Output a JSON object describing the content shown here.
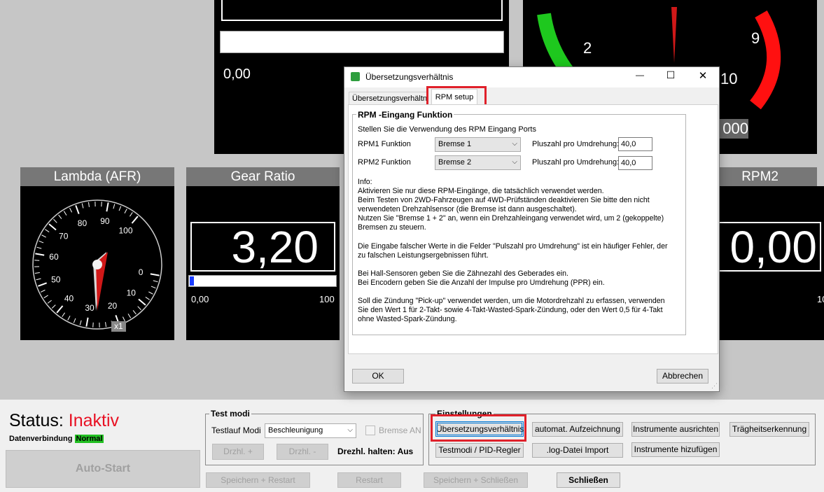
{
  "top_panels": {
    "left_value_text": "0,00",
    "right_gauge_ticks": [
      "2",
      "9",
      "10"
    ],
    "right_digit_text": "000"
  },
  "gauges": {
    "lambda": {
      "title": "Lambda (AFR)",
      "ticks": [
        "0",
        "10",
        "20",
        "30",
        "40",
        "50",
        "60",
        "70",
        "80",
        "90",
        "100"
      ],
      "multiplier": "x1"
    },
    "gear_ratio": {
      "title": "Gear Ratio",
      "value": "3,20",
      "bar_min": "0,00",
      "bar_max": "100",
      "bar_fraction": 0.03
    },
    "rpm2": {
      "title": "RPM2",
      "value": "0,00",
      "bar_max_partial": "10"
    }
  },
  "dialog": {
    "title": "Übersetzungsverhältnis",
    "window_buttons": {
      "minimize": "—",
      "maximize": "☐",
      "close": "✕"
    },
    "tabs": [
      {
        "label": "Übersetzungsverhältnis",
        "active": false
      },
      {
        "label": "RPM setup",
        "active": true
      }
    ],
    "group_title": "RPM -Eingang Funktion",
    "intro": "Stellen Sie die Verwendung des RPM Eingang Ports",
    "rpm1": {
      "label": "RPM1 Funktion",
      "select": "Bremse 1",
      "pulse_label": "Pluszahl pro Umdrehung:",
      "pulse_value": "40,0"
    },
    "rpm2": {
      "label": "RPM2 Funktion",
      "select": "Bremse 2",
      "pulse_label": "Pluszahl pro Umdrehung:",
      "pulse_value": "40,0"
    },
    "info": [
      "Info:",
      "Aktivieren Sie nur diese RPM-Eingänge, die tatsächlich verwendet werden.",
      "Beim Testen von 2WD-Fahrzeugen auf 4WD-Prüfständen deaktivieren Sie bitte den nicht",
      "verwendeten Drehzahlsensor (die Bremse ist dann ausgeschaltet).",
      "Nutzen Sie \"Bremse 1 + 2\" an, wenn ein Drehzahleingang verwendet wird, um 2 (gekoppelte)",
      "Bremsen zu steuern.",
      "",
      "Die Eingabe falscher Werte in die Felder \"Pulszahl pro Umdrehung\" ist ein häufiger Fehler, der",
      "zu falschen Leistungsergebnissen führt.",
      "",
      "Bei Hall-Sensoren geben Sie die Zähnezahl des Geberades ein.",
      "Bei Encodern geben Sie die Anzahl der Impulse pro Umdrehung (PPR) ein.",
      "",
      "Soll die Zündung \"Pick-up\" verwendet werden, um die Motordrehzahl zu erfassen, verwenden",
      "Sie den Wert 1 für 2-Takt- sowie 4-Takt-Wasted-Spark-Zündung, oder den Wert 0,5 für 4-Takt",
      "ohne Wasted-Spark-Zündung."
    ],
    "ok_label": "OK",
    "cancel_label": "Abbrechen"
  },
  "status": {
    "label": "Status:",
    "value": "Inaktiv",
    "connection_label": "Datenverbindung",
    "connection_badge": "Normal",
    "autostart_label": "Auto-Start"
  },
  "test_modi": {
    "title": "Test modi",
    "testlauf_label": "Testlauf Modi",
    "testlauf_value": "Beschleunigung",
    "bremse_an_label": "Bremse AN",
    "drzhl_plus": "Drzhl. +",
    "drzhl_minus": "Drzhl. -",
    "drehzahl_halten": "Drezhl. halten: Aus"
  },
  "einstellungen": {
    "title": "Einstellungen",
    "buttons_row1": [
      "Übersetzungsverhältnis",
      "automat. Aufzeichnung",
      "Instrumente ausrichten",
      "Trägheitserkennung"
    ],
    "buttons_row2": [
      "Testmodi / PID-Regler",
      ".log-Datei Import",
      "Instrumente hizufügen"
    ]
  },
  "bottom_buttons": {
    "save_restart": "Speichern + Restart",
    "restart": "Restart",
    "save_close": "Speichern + Schließen",
    "close": "Schließen"
  },
  "colors": {
    "status_inactive": "#e81123",
    "badge_green": "#22c022",
    "gauge_red": "#ff1010",
    "gauge_green": "#1ec81e",
    "highlight_frame": "#e0202a",
    "progress_blue": "#1a3cff"
  }
}
